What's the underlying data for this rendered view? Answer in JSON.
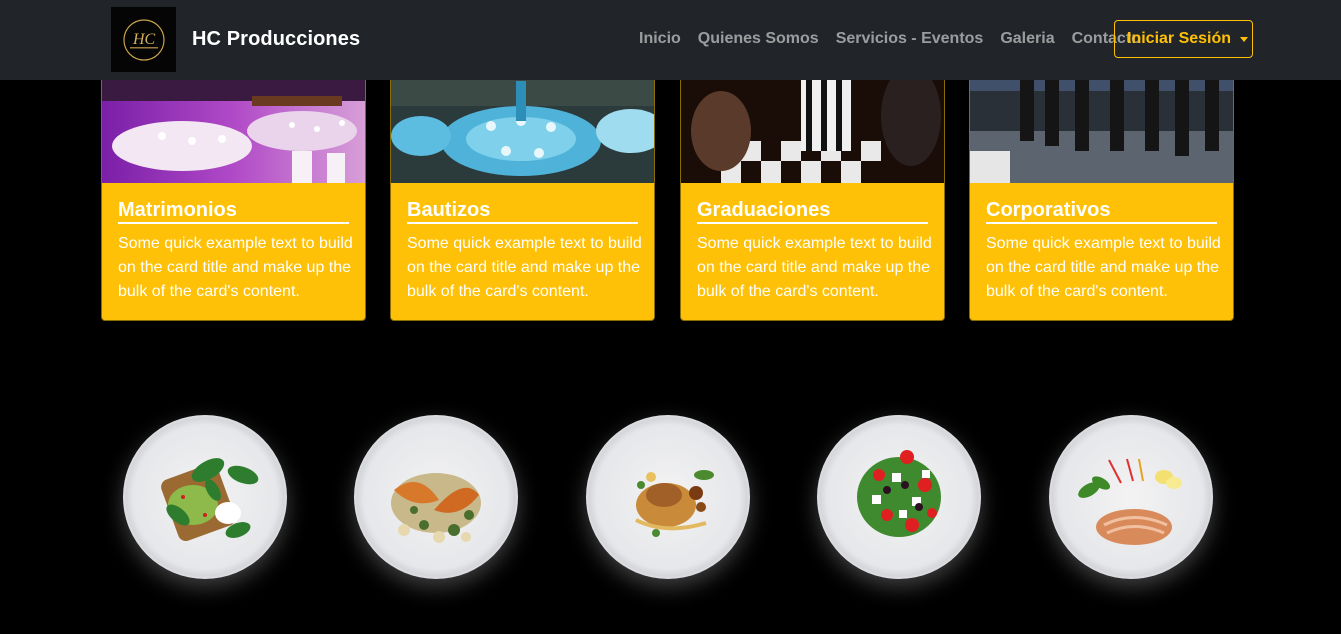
{
  "navbar": {
    "brand_name": "HC Producciones",
    "links": [
      "Inicio",
      "Quienes Somos",
      "Servicios - Eventos",
      "Galeria",
      "Contacto"
    ],
    "login_label": "Iniciar Sesión"
  },
  "cards": [
    {
      "title": "Matrimonios",
      "text": "Some quick example text to build on the card title and make up the bulk of the card's content."
    },
    {
      "title": "Bautizos",
      "text": "Some quick example text to build on the card title and make up the bulk of the card's content."
    },
    {
      "title": "Graduaciones",
      "text": "Some quick example text to build on the card title and make up the bulk of the card's content."
    },
    {
      "title": "Corporativos",
      "text": "Some quick example text to build on the card title and make up the bulk of the card's content."
    }
  ],
  "colors": {
    "navbar_bg": "#212529",
    "accent": "#ffc107",
    "page_bg": "#000000"
  }
}
